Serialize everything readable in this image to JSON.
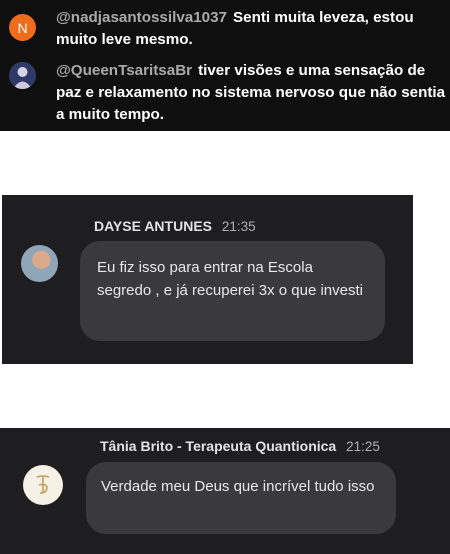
{
  "youtube_chat": {
    "messages": [
      {
        "avatar_initial": "N",
        "author": "@nadjasantossilva1037",
        "text": "Senti muita leveza, estou muito leve mesmo."
      },
      {
        "author": "@QueenTsaritsaBr",
        "text": "tiver visões e uma sensação de paz e relaxamento no sistema nervoso que não sentia a muito tempo."
      }
    ],
    "colors": {
      "background": "#0f0f0f",
      "author": "#aaaaaa",
      "avatar_orange": "#ef6c1a"
    }
  },
  "dm_chat_1": {
    "sender": "DAYSE ANTUNES",
    "time": "21:35",
    "message": "Eu fiz isso para entrar na Escola segredo , e já recuperei 3x o que investi"
  },
  "dm_chat_2": {
    "sender": "Tânia Brito - Terapeuta Quantionica",
    "time": "21:25",
    "avatar_icon": "logo-monogram-icon",
    "message": "Verdade meu Deus que incrível tudo isso"
  }
}
